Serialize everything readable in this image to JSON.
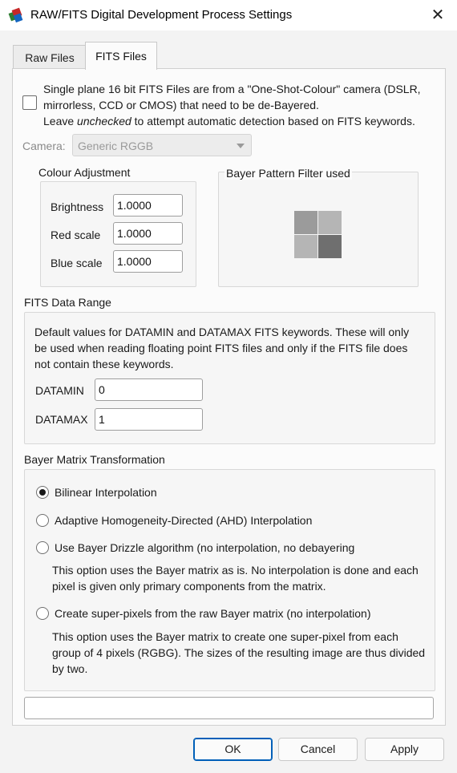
{
  "window": {
    "title": "RAW/FITS Digital Development Process Settings",
    "close_label": "✕"
  },
  "tabs": [
    {
      "label": "Raw Files",
      "active": false
    },
    {
      "label": "FITS Files",
      "active": true
    }
  ],
  "osc": {
    "checked": false,
    "line1": "Single plane 16 bit FITS Files are from a \"One-Shot-Colour\" camera (DSLR, mirrorless, CCD or CMOS) that need to be de-Bayered.",
    "line2_pre": "Leave ",
    "line2_em": "unchecked",
    "line2_post": " to attempt automatic detection based on FITS keywords."
  },
  "camera": {
    "label": "Camera:",
    "selected": "Generic RGGB",
    "enabled": false
  },
  "colour_adjustment": {
    "title": "Colour Adjustment",
    "brightness_label": "Brightness",
    "brightness_value": "1.0000",
    "red_label": "Red scale",
    "red_value": "1.0000",
    "blue_label": "Blue scale",
    "blue_value": "1.0000"
  },
  "bayer_pattern": {
    "title": "Bayer Pattern Filter used",
    "colors": [
      "#9b9b9b",
      "#b5b5b5",
      "#b5b5b5",
      "#6f6f6f"
    ]
  },
  "fits_range": {
    "title": "FITS Data Range",
    "description": "Default values for DATAMIN and DATAMAX FITS keywords.   These will only be used when reading floating point FITS files and only if the FITS file does not contain these keywords.",
    "datamin_label": "DATAMIN",
    "datamin_value": "0",
    "datamax_label": "DATAMAX",
    "datamax_value": "1"
  },
  "bayer_transform": {
    "title": "Bayer Matrix Transformation",
    "options": [
      {
        "label": "Bilinear Interpolation",
        "checked": true
      },
      {
        "label": "Adaptive Homogeneity-Directed (AHD) Interpolation",
        "checked": false
      },
      {
        "label": "Use Bayer Drizzle algorithm (no interpolation, no debayering",
        "checked": false,
        "description": "This option uses the Bayer matrix as is. No interpolation is done and each pixel is given only primary components from the matrix."
      },
      {
        "label": "Create super-pixels from the raw Bayer matrix (no interpolation)",
        "checked": false,
        "description": "This option uses the Bayer matrix to create one super-pixel from each group of 4 pixels (RGBG). The sizes of the resulting image are thus divided by two."
      }
    ]
  },
  "buttons": {
    "ok": "OK",
    "cancel": "Cancel",
    "apply": "Apply"
  }
}
